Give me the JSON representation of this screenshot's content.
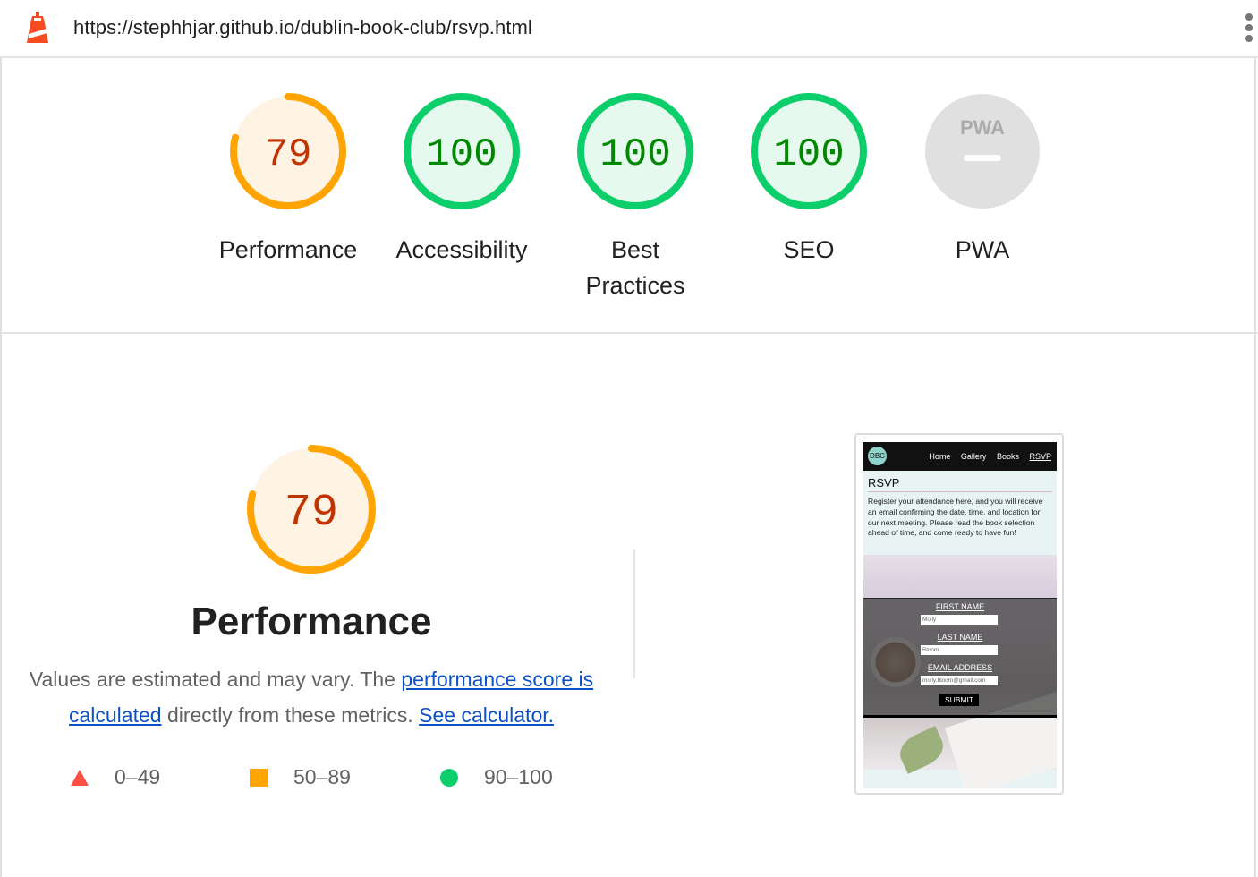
{
  "topbar": {
    "url": "https://stephhjar.github.io/dublin-book-club/rsvp.html",
    "icons": [
      "lighthouse-logo-icon",
      "kebab-menu-icon"
    ]
  },
  "colors": {
    "average": "#ffa400",
    "average_text": "#c33300",
    "average_bg": "#fff3e4",
    "pass": "#0cce6b",
    "pass_text": "#008800",
    "pass_bg": "#e5f9ef",
    "fail": "#ff4e42",
    "na": "#e0e0e0"
  },
  "gauges": [
    {
      "label": "Performance",
      "score": "79",
      "value": 79
    },
    {
      "label": "Accessibility",
      "score": "100",
      "value": 100
    },
    {
      "label": "Best Practices",
      "score": "100",
      "value": 100
    },
    {
      "label": "SEO",
      "score": "100",
      "value": 100
    },
    {
      "label": "PWA",
      "badge": "PWA"
    }
  ],
  "category": {
    "score": "79",
    "value": 79,
    "title": "Performance",
    "description_prefix": "Values are estimated and may vary. The ",
    "score_link": "performance score is calculated",
    "description_middle": " directly from these metrics. ",
    "calc_link": "See calculator.",
    "legend": [
      {
        "range": "0–49",
        "shape": "triangle"
      },
      {
        "range": "50–89",
        "shape": "square"
      },
      {
        "range": "90–100",
        "shape": "circle"
      }
    ]
  },
  "thumbnail": {
    "logo": "DBC",
    "nav": [
      "Home",
      "Gallery",
      "Books",
      "RSVP"
    ],
    "heading": "RSVP",
    "paragraph": "Register your attendance here, and you will receive an email confirming the date, time, and location for our next meeting. Please read the book selection ahead of time, and come ready to have fun!",
    "form": {
      "first_name_label": "FIRST NAME",
      "first_name_value": "Molly",
      "last_name_label": "LAST NAME",
      "last_name_value": "Bloom",
      "email_label": "EMAIL ADDRESS",
      "email_value": "molly.bloom@gmail.com",
      "submit": "SUBMIT"
    }
  }
}
